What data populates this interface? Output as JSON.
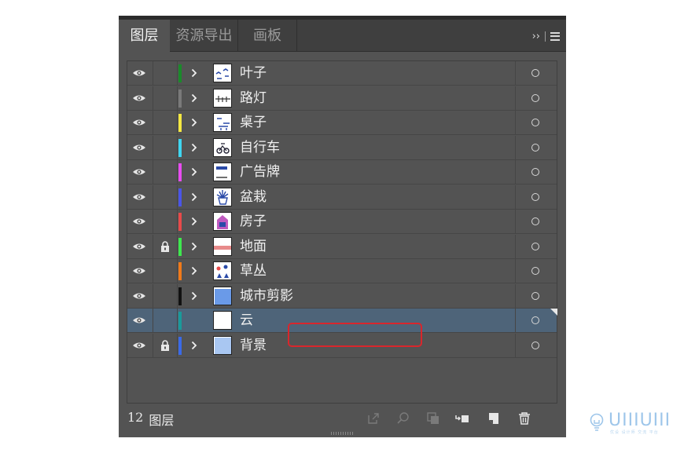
{
  "tabs": [
    {
      "label": "图层",
      "active": true
    },
    {
      "label": "资源导出",
      "active": false
    },
    {
      "label": "画板",
      "active": false
    }
  ],
  "panel_menu": {
    "expand_label": "››"
  },
  "layers": [
    {
      "name": "叶子",
      "color": "#1a8a2a",
      "locked": false,
      "expandable": true,
      "selected": false
    },
    {
      "name": "路灯",
      "color": "#7a7a7a",
      "locked": false,
      "expandable": true,
      "selected": false
    },
    {
      "name": "桌子",
      "color": "#f4e842",
      "locked": false,
      "expandable": true,
      "selected": false
    },
    {
      "name": "自行车",
      "color": "#3fd6f0",
      "locked": false,
      "expandable": true,
      "selected": false
    },
    {
      "name": "广告牌",
      "color": "#e84cf0",
      "locked": false,
      "expandable": true,
      "selected": false
    },
    {
      "name": "盆栽",
      "color": "#4a55e8",
      "locked": false,
      "expandable": true,
      "selected": false
    },
    {
      "name": "房子",
      "color": "#e84a4a",
      "locked": false,
      "expandable": true,
      "selected": false
    },
    {
      "name": "地面",
      "color": "#3ee84e",
      "locked": true,
      "expandable": true,
      "selected": false
    },
    {
      "name": "草丛",
      "color": "#f07a1a",
      "locked": false,
      "expandable": true,
      "selected": false
    },
    {
      "name": "城市剪影",
      "color": "#111111",
      "locked": false,
      "expandable": true,
      "selected": false
    },
    {
      "name": "云",
      "color": "#1a9a9a",
      "locked": false,
      "expandable": false,
      "selected": true
    },
    {
      "name": "背景",
      "color": "#3a6ae8",
      "locked": true,
      "expandable": true,
      "selected": false
    }
  ],
  "footer": {
    "count": "12",
    "count_label": "图层"
  },
  "watermark": {
    "text": "UIIIUIII",
    "sub": "优设 设计师 交流 平台"
  }
}
